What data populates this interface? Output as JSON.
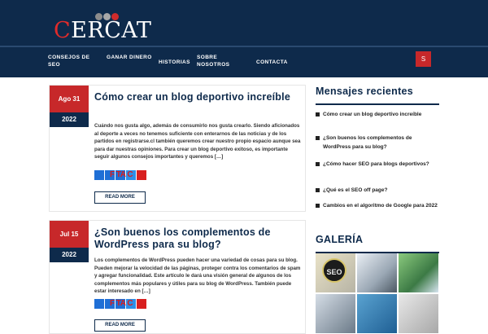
{
  "logo": {
    "first_letter": "C",
    "rest": "ERCAT"
  },
  "nav": {
    "items": [
      {
        "label": "CONSEJOS DE SEO"
      },
      {
        "label": "GANAR DINERO"
      },
      {
        "label": "HISTORIAS"
      },
      {
        "label": "SOBRE NOSOTROS"
      },
      {
        "label": "CONTACTA"
      }
    ],
    "search_glyph": "S",
    "search_icon": "search-icon"
  },
  "posts": [
    {
      "date_day": "Ago 31",
      "date_year": "2022",
      "title": "Cómo crear un blog deportivo increíble",
      "excerpt": "Cuándo nos gusta algo, además de consumirlo nos gusta crearlo. Siendo aficionados al deporte a veces no tenemos suficiente con enterarnos de las noticias y de los partidos en registrarse.cl también queremos crear nuestro propio espacio aunque sea para dar nuestras opiniones. Para crear un blog deportivo exitoso, es importante seguir algunos consejos importantes y queremos […]",
      "share_text": "F  TA  C",
      "read_more": "READ MORE"
    },
    {
      "date_day": "Jul 15",
      "date_year": "2022",
      "title": "¿Son buenos los complementos de WordPress para su blog?",
      "excerpt": "Los complementos de WordPress pueden hacer una variedad de cosas para su blog. Pueden mejorar la velocidad de las páginas, proteger contra los comentarios de spam y agregar funcionalidad. Este artículo le dará una visión general de algunos de los complementos más populares y útiles para su blog de WordPress. También puede estar interesado en […]",
      "share_text": "F  TA  C",
      "read_more": "READ MORE"
    }
  ],
  "sidebar": {
    "recent_title": "Mensajes recientes",
    "recent_items": [
      {
        "label": "Cómo crear un blog deportivo increíble"
      },
      {
        "label": "¿Son buenos los complementos de WordPress para su blog?"
      },
      {
        "label": "¿Cómo hacer SEO para blogs deportivos?"
      },
      {
        "label": "¿Qué es el SEO off page?"
      },
      {
        "label": "Cambios en el algoritmo de Google para 2022"
      }
    ],
    "gallery_title": "GALERÍA",
    "gallery_badge": "SEO"
  },
  "colors": {
    "header_bg": "#0e2a4b",
    "accent_red": "#c7282a"
  }
}
